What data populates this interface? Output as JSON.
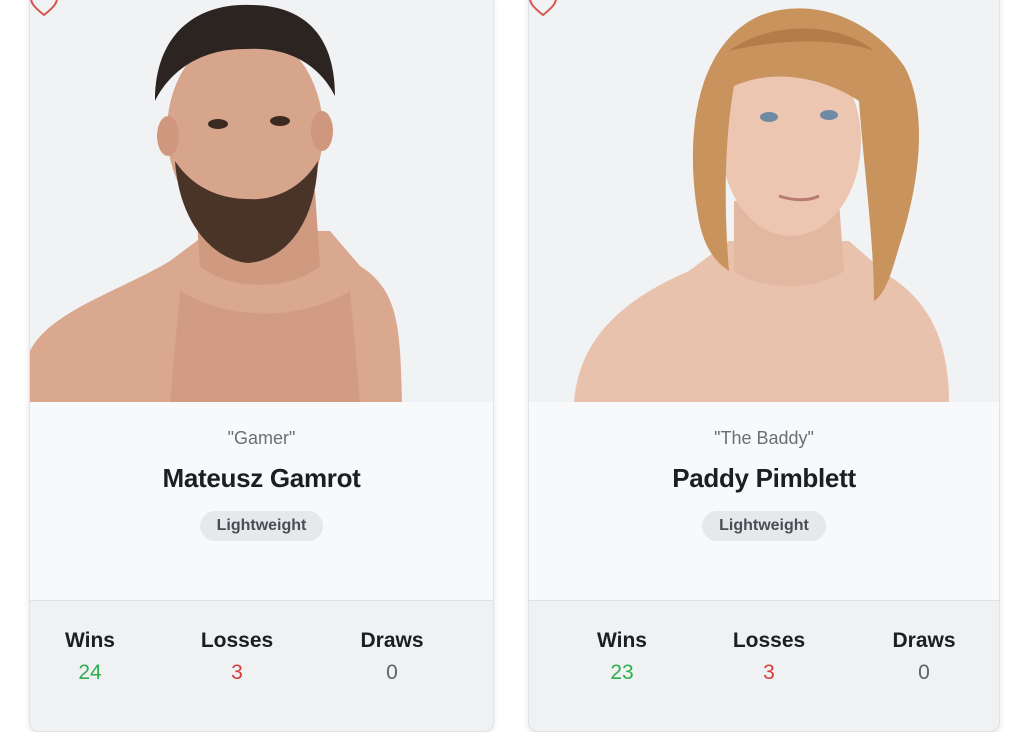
{
  "colors": {
    "wins": "#2fae4e",
    "losses": "#d63b3b",
    "draws": "#5f6368",
    "heart": "#d9534f"
  },
  "fighters": [
    {
      "nickname": "\"Gamer\"",
      "name": "Mateusz Gamrot",
      "division": "Lightweight",
      "favorite_icon": "heart-outline-icon",
      "stats": {
        "wins_label": "Wins",
        "wins": "24",
        "losses_label": "Losses",
        "losses": "3",
        "draws_label": "Draws",
        "draws": "0"
      }
    },
    {
      "nickname": "\"The Baddy\"",
      "name": "Paddy Pimblett",
      "division": "Lightweight",
      "favorite_icon": "heart-outline-icon",
      "stats": {
        "wins_label": "Wins",
        "wins": "23",
        "losses_label": "Losses",
        "losses": "3",
        "draws_label": "Draws",
        "draws": "0"
      }
    }
  ]
}
